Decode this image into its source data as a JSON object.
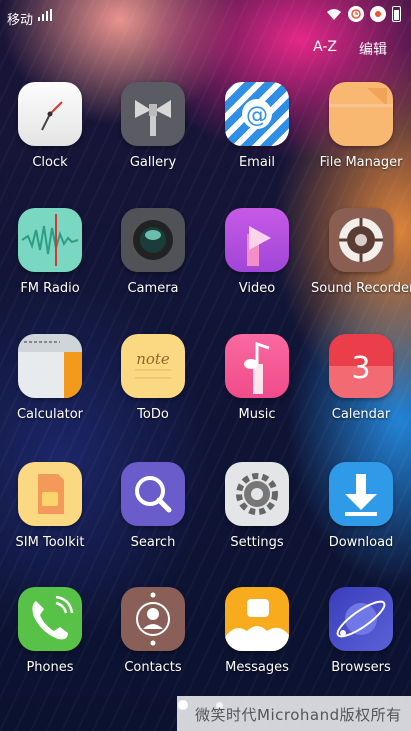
{
  "status_bar": {
    "carrier": "移动"
  },
  "top_actions": {
    "sort_label": "A-Z",
    "edit_label": "编辑"
  },
  "apps": [
    {
      "label": "Clock"
    },
    {
      "label": "Gallery"
    },
    {
      "label": "Email"
    },
    {
      "label": "File Manager"
    },
    {
      "label": "FM Radio"
    },
    {
      "label": "Camera"
    },
    {
      "label": "Video"
    },
    {
      "label": "Sound Recorder"
    },
    {
      "label": "Calculator"
    },
    {
      "label": "ToDo"
    },
    {
      "label": "Music"
    },
    {
      "label": "Calendar"
    },
    {
      "label": "SIM Toolkit"
    },
    {
      "label": "Search"
    },
    {
      "label": "Settings"
    },
    {
      "label": "Download"
    },
    {
      "label": "Phones"
    },
    {
      "label": "Contacts"
    },
    {
      "label": "Messages"
    },
    {
      "label": "Browsers"
    }
  ],
  "todo_note_text": "note",
  "calendar_day": "3",
  "watermark": "微笑时代Microhand版权所有",
  "colors": {
    "label": "#ffffff",
    "accent_pink": "#f0288c",
    "calendar_red": "#ea3f4b"
  }
}
